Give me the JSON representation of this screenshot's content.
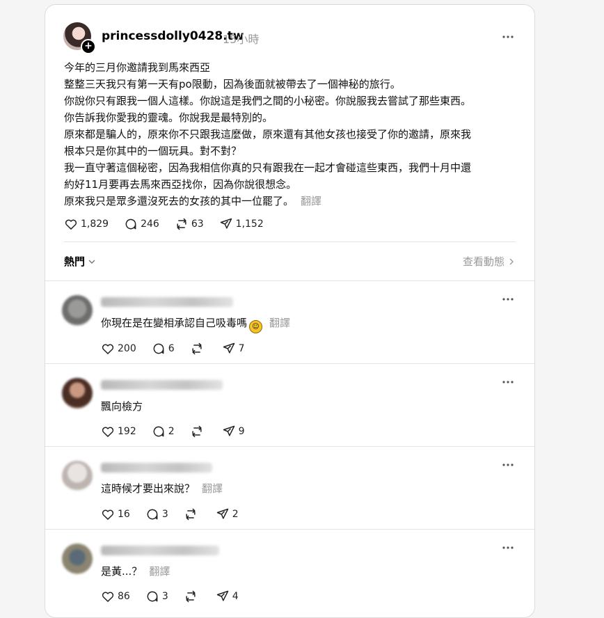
{
  "post": {
    "username": "princessdolly0428.tw",
    "time": "15小時",
    "lines": [
      "今年的三月你邀請我到馬來西亞",
      "整整三天我只有第一天有po限動，因為後面就被帶去了一個神秘的旅行。",
      "你說你只有跟我一個人這樣。你說這是我們之間的小秘密。你說服我去嘗試了那些東西。",
      "你告訴我你愛我的靈魂。你說我是最特別的。",
      "原來都是騙人的，原來你不只跟我這麼做，原來還有其他女孩也接受了你的邀請，原來我",
      "根本只是你其中的一個玩具。對不對？",
      "我一直守著這個秘密，因為我相信你真的只有跟我在一起才會碰這些東西，我們十月中還",
      "約好11月要再去馬來西亞找你，因為你說很想念。",
      "原來我只是眾多還沒死去的女孩的其中一位罷了。"
    ],
    "translate": "翻譯",
    "likes": "1,829",
    "comments": "246",
    "reposts": "63",
    "shares": "1,152"
  },
  "sort": {
    "label": "熱門",
    "activity": "查看動態"
  },
  "comments": [
    {
      "text": "你現在是在變相承認自己吸毒嗎",
      "emoji": "face-emoji",
      "translate": "翻譯",
      "likes": "200",
      "replies": "6",
      "reposts": "",
      "shares": "7"
    },
    {
      "text": "飄向檢方",
      "translate": "",
      "likes": "192",
      "replies": "2",
      "reposts": "",
      "shares": "9"
    },
    {
      "text": "這時候才要出來說？",
      "translate": "翻譯",
      "likes": "16",
      "replies": "3",
      "reposts": "",
      "shares": "2"
    },
    {
      "text": "是黃...？",
      "translate": "翻譯",
      "likes": "86",
      "replies": "3",
      "reposts": "",
      "shares": "4"
    }
  ]
}
